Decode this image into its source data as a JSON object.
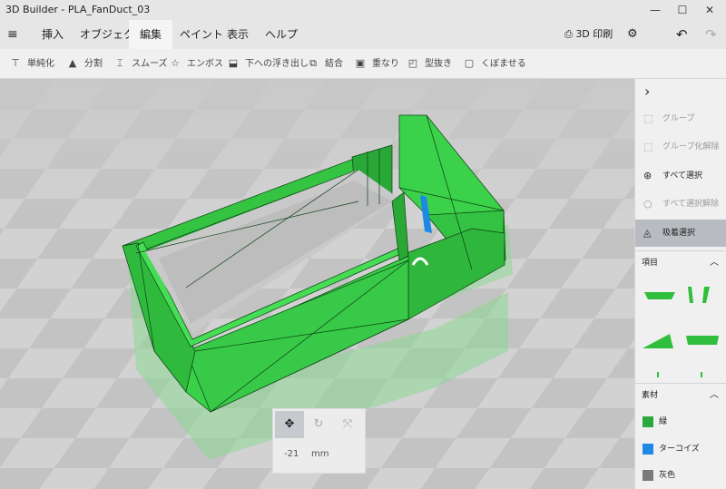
{
  "window": {
    "title": "3D Builder - PLA_FanDuct_03",
    "minimize": "—",
    "maximize": "☐",
    "close": "✕"
  },
  "menu": {
    "hamburger": "≡",
    "tabs": [
      {
        "label": "挿入"
      },
      {
        "label": "オブジェクト"
      },
      {
        "label": "編集"
      },
      {
        "label": "ペイント"
      },
      {
        "label": "表示"
      },
      {
        "label": "ヘルプ"
      }
    ],
    "active_tab": "編集",
    "print_label": "3D 印刷",
    "undo": "↶",
    "redo": "↷"
  },
  "toolbar": {
    "tools": [
      {
        "label": "単純化",
        "icon": "simplify-icon"
      },
      {
        "label": "分割",
        "icon": "split-icon"
      },
      {
        "label": "スムーズ",
        "icon": "smooth-icon"
      },
      {
        "label": "エンボス",
        "icon": "emboss-icon"
      },
      {
        "label": "下への浮き出し",
        "icon": "extrude-down-icon"
      },
      {
        "label": "結合",
        "icon": "merge-icon"
      },
      {
        "label": "重なり",
        "icon": "intersect-icon"
      },
      {
        "label": "型抜き",
        "icon": "subtract-icon"
      },
      {
        "label": "くぼませる",
        "icon": "hollow-icon"
      }
    ]
  },
  "panel": {
    "collapse": "›",
    "actions": [
      {
        "label": "グループ",
        "enabled": false,
        "icon": "group-icon"
      },
      {
        "label": "グループ化解除",
        "enabled": false,
        "icon": "ungroup-icon"
      },
      {
        "label": "すべて選択",
        "enabled": true,
        "icon": "select-all-icon"
      },
      {
        "label": "すべて選択解除",
        "enabled": false,
        "icon": "deselect-all-icon"
      },
      {
        "label": "吸着選択",
        "enabled": true,
        "active": true,
        "icon": "lasso-select-icon"
      }
    ],
    "items_header": "項目",
    "materials_header": "素材",
    "materials": [
      {
        "label": "緑",
        "color": "#2aaa3c"
      },
      {
        "label": "ターコイズ",
        "color": "#1e88e5"
      },
      {
        "label": "灰色",
        "color": "#7a7a7a"
      }
    ]
  },
  "gizmo": {
    "value": "-21",
    "unit": "mm"
  },
  "colors": {
    "model_green": "#2fbf3d",
    "accent": "#0078d7"
  }
}
